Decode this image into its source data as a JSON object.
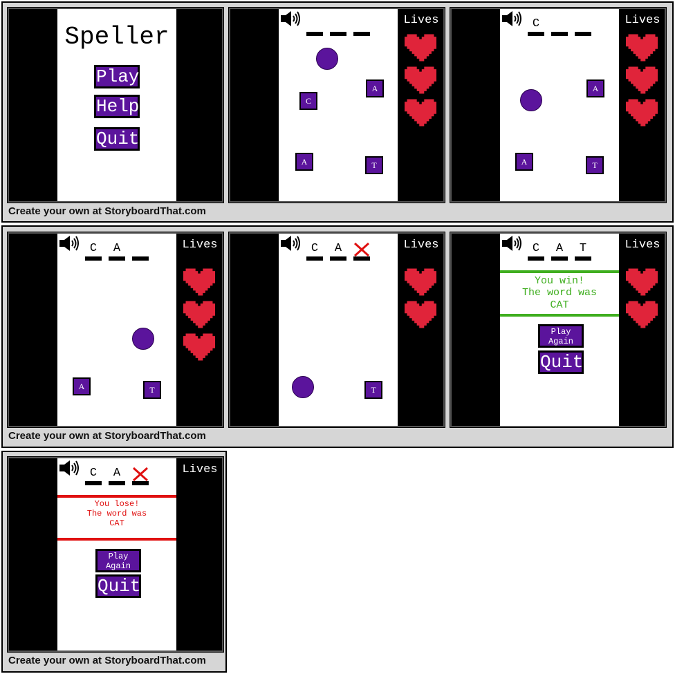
{
  "footer_text": "Create your own at StoryboardThat.com",
  "colors": {
    "tile_purple": "#5b149c",
    "heart_red": "#e0243a",
    "win_green": "#3fae1f",
    "lose_red": "#e01010"
  },
  "icons": {
    "speaker": "speaker-icon",
    "heart": "heart-icon",
    "x": "x-mark-icon"
  },
  "menu": {
    "title": "Speller",
    "play": "Play",
    "help": "Help",
    "quit": "Quit"
  },
  "hud": {
    "lives_label": "Lives"
  },
  "letters": {
    "c": "C",
    "a": "A",
    "t": "T"
  },
  "win": {
    "line1": "You win!",
    "line2": "The word was",
    "line3": "CAT",
    "play_again_1": "Play",
    "play_again_2": "Again",
    "quit": "Quit"
  },
  "lose": {
    "line1": "You lose!",
    "line2": "The word was",
    "line3": "CAT",
    "play_again_1": "Play",
    "play_again_2": "Again",
    "quit": "Quit"
  },
  "lives_remaining": [
    3,
    3,
    3,
    2,
    2,
    0
  ]
}
